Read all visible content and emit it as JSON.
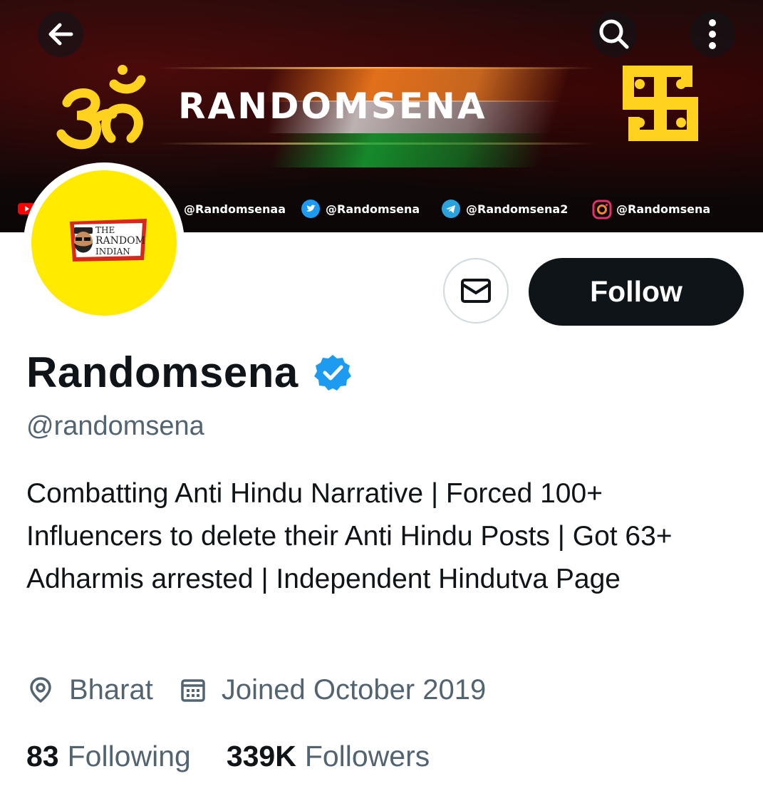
{
  "banner": {
    "title": "RANDOMSENA",
    "socials": [
      {
        "platform": "youtube-icon",
        "handle": "@Randomsenaa"
      },
      {
        "platform": "twitter-icon",
        "handle": "@Randomsena"
      },
      {
        "platform": "telegram-icon",
        "handle": "@Randomsena2"
      },
      {
        "platform": "instagram-icon",
        "handle": "@Randomsena"
      }
    ]
  },
  "avatar": {
    "logo_lines": [
      "THE",
      "RANDOM",
      "INDIAN"
    ],
    "background": "#ffea00"
  },
  "actions": {
    "follow_label": "Follow"
  },
  "profile": {
    "name": "Randomsena",
    "handle": "@randomsena",
    "bio": "Combatting Anti Hindu Narrative | Forced 100+ Influencers to delete their Anti Hindu Posts | Got 63+ Adharmis arrested | Independent Hindutva Page",
    "location": "Bharat",
    "joined": "Joined October 2019",
    "following_count": "83",
    "following_label": "Following",
    "followers_count": "339K",
    "followers_label": "Followers"
  },
  "colors": {
    "accent_verified": "#1d9bf0",
    "secondary_text": "#536471",
    "primary_text": "#0f1419",
    "gold": "#ffd21f"
  }
}
